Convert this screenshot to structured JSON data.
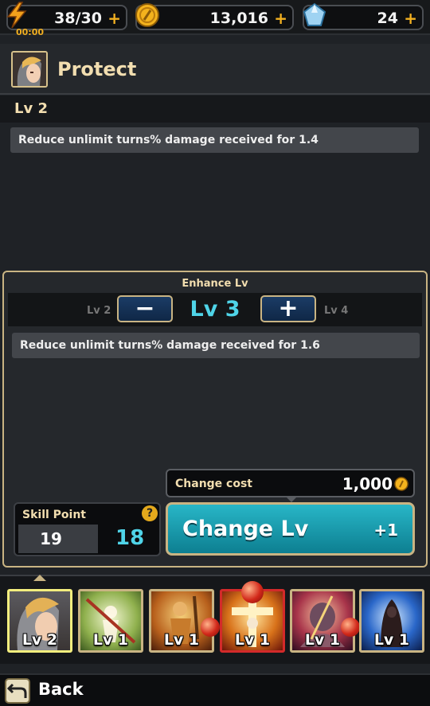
{
  "resources": {
    "stamina": {
      "value": "38/30",
      "timer": "00:00",
      "icon": "lightning-icon"
    },
    "gold": {
      "value": "13,016",
      "icon": "gold-coin-icon"
    },
    "gems": {
      "value": "24",
      "icon": "crystal-icon"
    },
    "plus_label": "+"
  },
  "skill": {
    "name": "Protect",
    "current_level": "Lv 2",
    "current_desc": "Reduce unlimit turns% damage received for 1.4"
  },
  "enhance": {
    "title": "Enhance Lv",
    "prev_level": "Lv 2",
    "target_level": "Lv 3",
    "next_level": "Lv 4",
    "minus_label": "−",
    "plus_label": "+",
    "desc": "Reduce unlimit turns% damage received for 1.6"
  },
  "cost": {
    "label": "Change cost",
    "value": "1,000"
  },
  "skill_point": {
    "label": "Skill Point",
    "current": "19",
    "after": "18",
    "help": "?"
  },
  "change_button": {
    "label": "Change Lv",
    "delta": "+1"
  },
  "slots": [
    {
      "level": "Lv 2",
      "selected": true
    },
    {
      "level": "Lv 1"
    },
    {
      "level": "Lv 1"
    },
    {
      "level": "Lv 1"
    },
    {
      "level": "Lv 1"
    },
    {
      "level": "Lv 1"
    }
  ],
  "back": {
    "label": "Back"
  },
  "colors": {
    "accent_cyan": "#4fd4e8",
    "gold_trim": "#c9b483",
    "cream_text": "#f2deb0",
    "plus_orange": "#f2b021"
  }
}
